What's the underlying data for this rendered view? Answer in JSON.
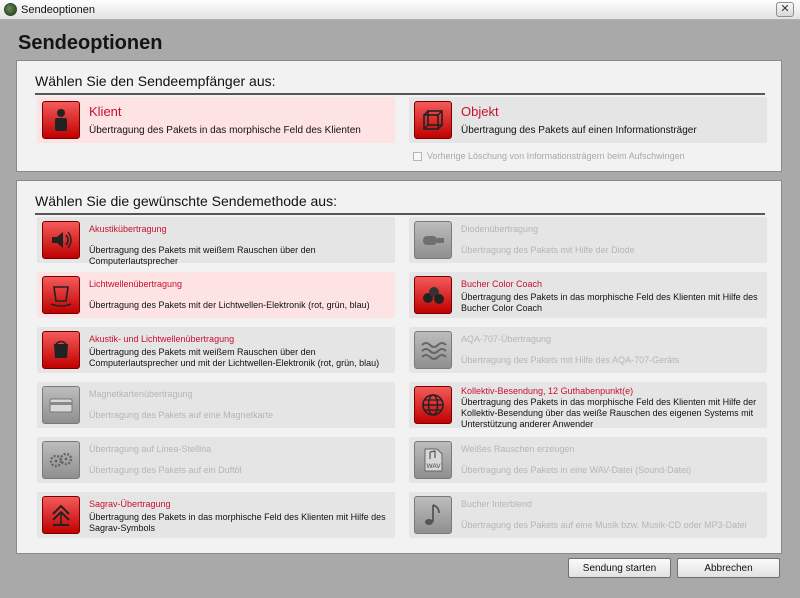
{
  "window": {
    "title": "Sendeoptionen"
  },
  "header": {
    "title": "Sendeoptionen"
  },
  "recipient_section": {
    "title": "Wählen Sie den Sendeempfänger aus:",
    "options": [
      {
        "name": "Klient",
        "description": "Übertragung des Pakets in das morphische Feld des Klienten",
        "icon": "person-icon"
      },
      {
        "name": "Objekt",
        "description": "Übertragung des Pakets auf einen Informationsträger",
        "icon": "cube-icon"
      }
    ],
    "checkbox_label": "Vorherige Löschung von Informationsträgern beim Aufschwingen"
  },
  "method_section": {
    "title": "Wählen Sie die gewünschte Sendemethode aus:",
    "left": [
      {
        "name": "Akustikübertragung",
        "description": "Übertragung des Pakets mit weißem Rauschen über den Computerlautsprecher",
        "icon": "speaker-icon"
      },
      {
        "name": "Lichtwellenübertragung",
        "description": "Übertragung des Pakets mit der Lichtwellen-Elektronik (rot, grün, blau)",
        "icon": "light-glass-icon"
      },
      {
        "name": "Akustik- und Lichtwellenübertragung",
        "description": "Übertragung des Pakets mit weißem Rauschen über den Computerlautsprecher und mit der Lichtwellen-Elektronik (rot, grün, blau)",
        "icon": "light-speaker-icon"
      },
      {
        "name": "Magnetkartenübertragung",
        "description": "Übertragung des Pakets auf eine Magnetkarte",
        "icon": "card-icon"
      },
      {
        "name": "Übertragung auf Linea-Stellina",
        "description": "Übertragung des Pakets auf ein Duftöl",
        "icon": "gears-icon"
      },
      {
        "name": "Sagrav-Übertragung",
        "description": "Übertragung des Pakets in das morphische Feld des Klienten mit Hilfe des Sagrav-Symbols",
        "icon": "sagrav-icon"
      }
    ],
    "right": [
      {
        "name": "Diodenübertragung",
        "description": "Übertragung des Pakets mit Hilfe der Diode",
        "icon": "diode-icon"
      },
      {
        "name": "Bucher Color Coach",
        "description": "Übertragung des Pakets in das morphische Feld des Klienten mit Hilfe des Bucher Color Coach",
        "icon": "color-coach-icon"
      },
      {
        "name": "AQA-707-Übertragung",
        "description": "Übertragung des Pakets mit Hilfe des AQA-707-Geräts",
        "icon": "waves-icon"
      },
      {
        "name": "Kollektiv-Besendung, 12 Guthabenpunkt(e)",
        "description": "Übertragung des Pakets in das morphische Feld des Klienten mit Hilfe der Kollektiv-Besendung über das weiße Rauschen des eigenen Systems mit Unterstützung anderer Anwender",
        "icon": "globe-icon"
      },
      {
        "name": "Weißes Rauschen erzeugen",
        "description": "Übertragung des Pakets in eine WAV-Datei (Sound-Datei)",
        "icon": "wav-file-icon",
        "icon_text": "WAV"
      },
      {
        "name": "Bucher Interblend",
        "description": "Übertragung des Pakets auf eine Musik bzw. Musik-CD oder MP3-Datei",
        "icon": "music-note-icon"
      }
    ]
  },
  "footer": {
    "start_label": "Sendung starten",
    "cancel_label": "Abbrechen"
  }
}
